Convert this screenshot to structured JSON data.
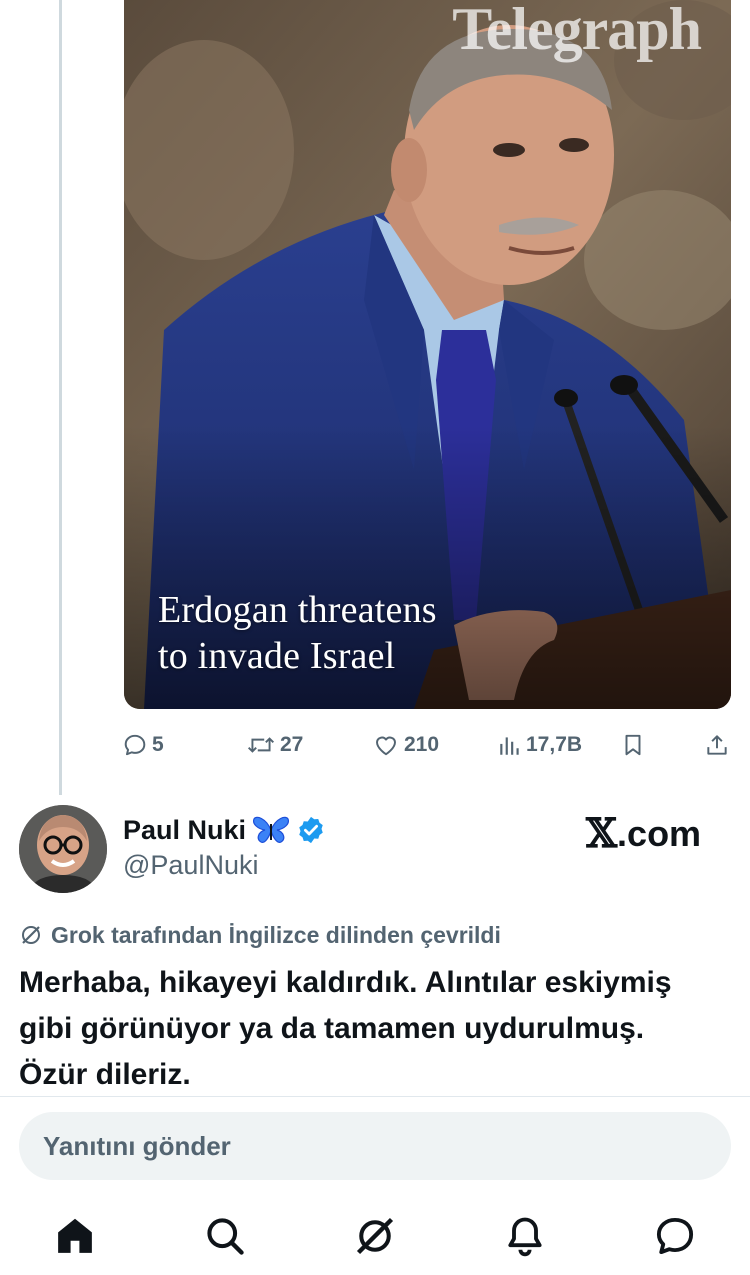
{
  "media": {
    "brand": "Telegraph",
    "headline_line1": "Erdogan threatens",
    "headline_line2": "to invade Israel"
  },
  "actions": {
    "replies": "5",
    "reposts": "27",
    "likes": "210",
    "views": "17,7B",
    "icons": [
      "reply-icon",
      "repost-icon",
      "like-icon",
      "views-icon",
      "bookmark-icon",
      "share-icon"
    ]
  },
  "author": {
    "name": "Paul Nuki",
    "handle": "@PaulNuki",
    "badge_color": "#1d9bf0",
    "emoji_icon": "butterfly-icon"
  },
  "brand_wordmark": {
    "mark": "𝕏",
    "suffix": ".com"
  },
  "translation_note": "Grok tarafından İngilizce dilinden çevrildi",
  "tweet_text": "Merhaba, hikayeyi kaldırdık. Alıntılar eskiymiş gibi görünüyor ya da tamamen uydurulmuş. Özür dileriz.",
  "reply": {
    "placeholder": "Yanıtını gönder"
  },
  "bottom_nav": [
    "home-icon",
    "search-icon",
    "grok-icon",
    "notifications-icon",
    "messages-icon"
  ],
  "colors": {
    "text": "#0f1419",
    "muted": "#536471",
    "verified": "#1d9bf0",
    "reply_bg": "#eff3f4"
  }
}
